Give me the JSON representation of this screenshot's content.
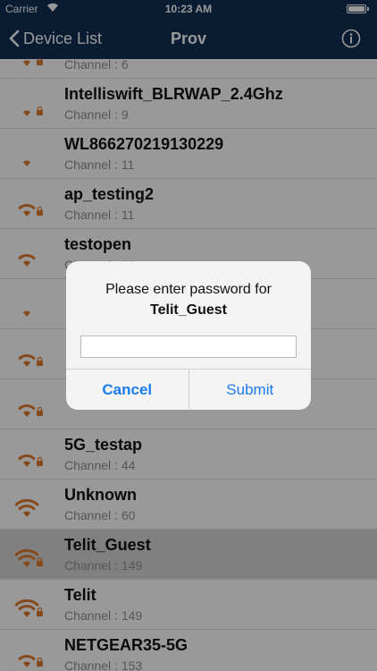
{
  "status_bar": {
    "carrier": "Carrier",
    "time": "10:23 AM"
  },
  "nav": {
    "back_label": "Device List",
    "title": "Prov"
  },
  "colors": {
    "nav_bg": "#0f2f52",
    "wifi_icon": "#e07a2e",
    "accent": "#1b7cf0"
  },
  "networks": [
    {
      "ssid": "",
      "channel": "Channel : 6",
      "signal": 1,
      "secure": true
    },
    {
      "ssid": "Intelliswift_BLRWAP_2.4Ghz",
      "channel": "Channel : 9",
      "signal": 1,
      "secure": true
    },
    {
      "ssid": "WL866270219130229",
      "channel": "Channel : 11",
      "signal": 1,
      "secure": false
    },
    {
      "ssid": "ap_testing2",
      "channel": "Channel : 11",
      "signal": 2,
      "secure": true
    },
    {
      "ssid": "testopen",
      "channel": "Channel : 36",
      "signal": 2,
      "secure": false
    },
    {
      "ssid": "",
      "channel": "",
      "signal": 1,
      "secure": false
    },
    {
      "ssid": "",
      "channel": "",
      "signal": 2,
      "secure": true
    },
    {
      "ssid": "",
      "channel": "",
      "signal": 2,
      "secure": true
    },
    {
      "ssid": "5G_testap",
      "channel": "Channel : 44",
      "signal": 2,
      "secure": true
    },
    {
      "ssid": "Unknown",
      "channel": "Channel : 60",
      "signal": 3,
      "secure": false
    },
    {
      "ssid": "Telit_Guest",
      "channel": "Channel : 149",
      "signal": 3,
      "secure": true,
      "selected": true
    },
    {
      "ssid": "Telit",
      "channel": "Channel : 149",
      "signal": 3,
      "secure": true
    },
    {
      "ssid": "NETGEAR35-5G",
      "channel": "Channel : 153",
      "signal": 2,
      "secure": true
    }
  ],
  "dialog": {
    "title_line1": "Please enter password for",
    "title_line2": "Telit_Guest",
    "password_value": "",
    "cancel_label": "Cancel",
    "submit_label": "Submit"
  }
}
